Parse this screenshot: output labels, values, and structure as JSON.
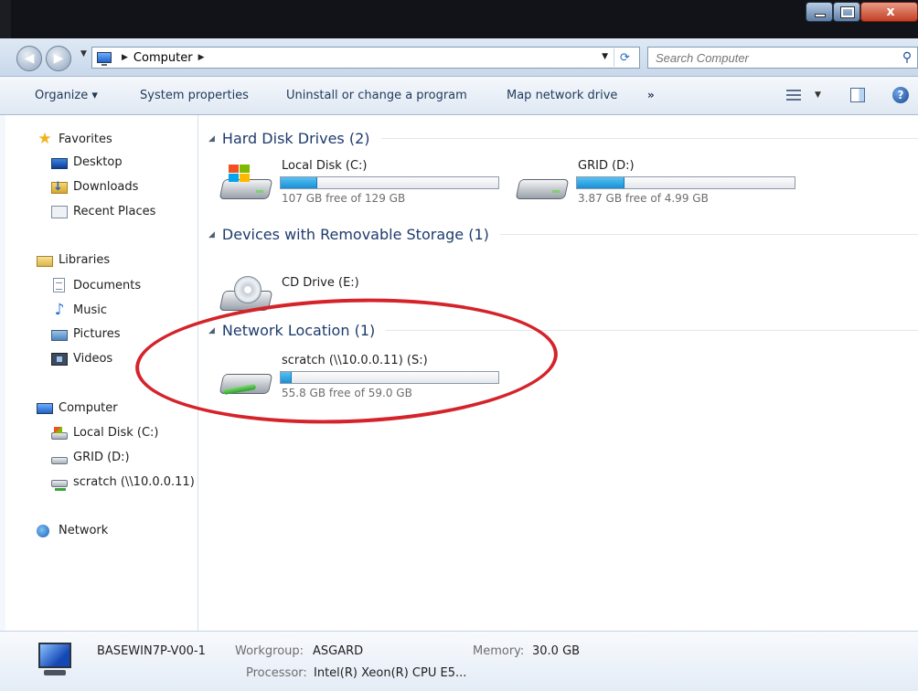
{
  "address": {
    "crumbs": [
      "Computer"
    ],
    "search_placeholder": "Search Computer"
  },
  "toolbar": {
    "organize": "Organize ▾",
    "system_properties": "System properties",
    "uninstall": "Uninstall or change a program",
    "map_drive": "Map network drive",
    "more": "»"
  },
  "nav": {
    "favorites": {
      "label": "Favorites",
      "items": [
        "Desktop",
        "Downloads",
        "Recent Places"
      ]
    },
    "libraries": {
      "label": "Libraries",
      "items": [
        "Documents",
        "Music",
        "Pictures",
        "Videos"
      ]
    },
    "computer": {
      "label": "Computer",
      "items": [
        "Local Disk (C:)",
        "GRID (D:)",
        "scratch (\\\\10.0.0.11)"
      ]
    },
    "network": {
      "label": "Network"
    }
  },
  "groups": [
    {
      "title": "Hard Disk Drives (2)",
      "drives": [
        {
          "name": "Local Disk (C:)",
          "free": "107 GB free of 129 GB",
          "used_fraction": 0.17
        },
        {
          "name": "GRID (D:)",
          "free": "3.87 GB free of 4.99 GB",
          "used_fraction": 0.22
        }
      ]
    },
    {
      "title": "Devices with Removable Storage (1)",
      "drives": [
        {
          "name": "CD Drive (E:)"
        }
      ]
    },
    {
      "title": "Network Location (1)",
      "drives": [
        {
          "name": "scratch (\\\\10.0.0.11) (S:)",
          "free": "55.8 GB free of 59.0 GB",
          "used_fraction": 0.05
        }
      ]
    }
  ],
  "details": {
    "pc_name": "BASEWIN7P-V00-1",
    "workgroup_label": "Workgroup:",
    "workgroup": "ASGARD",
    "memory_label": "Memory:",
    "memory": "30.0 GB",
    "processor_label": "Processor:",
    "processor": "Intel(R) Xeon(R) CPU E5..."
  },
  "colors": {
    "accent_bar": "#1b8fd6",
    "annotation": "#d5232a",
    "group_title": "#1e3b6d"
  }
}
